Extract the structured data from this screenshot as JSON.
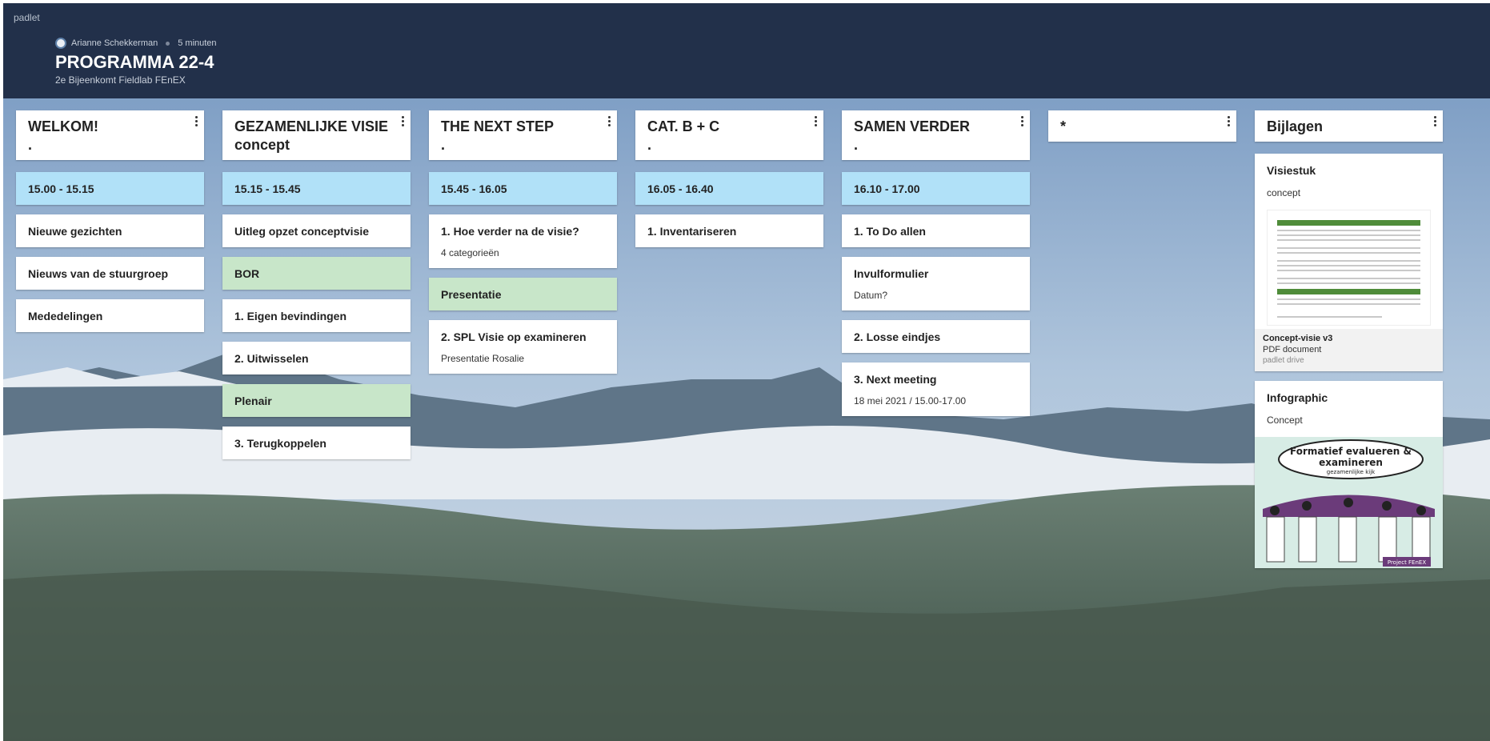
{
  "header": {
    "brand": "padlet",
    "author": "Arianne Schekkerman",
    "time": "5 minuten",
    "title": "PROGRAMMA 22-4",
    "subtitle": "2e Bijeenkomt Fieldlab FEnEX"
  },
  "columns": [
    {
      "title": "WELKOM!",
      "subtitle": ".",
      "time": "15.00 - 15.15",
      "cards": [
        {
          "title": "Nieuwe gezichten",
          "body": "",
          "color": "white"
        },
        {
          "title": "Nieuws van de stuurgroep",
          "body": "",
          "color": "white"
        },
        {
          "title": "Mededelingen",
          "body": "",
          "color": "white"
        }
      ]
    },
    {
      "title": "GEZAMENLIJKE VISIE",
      "subtitle": "concept",
      "time": "15.15 - 15.45",
      "cards": [
        {
          "title": "Uitleg opzet conceptvisie",
          "body": "",
          "color": "white"
        },
        {
          "title": "BOR",
          "body": "",
          "color": "green"
        },
        {
          "title": "1. Eigen bevindingen",
          "body": "",
          "color": "white"
        },
        {
          "title": "2. Uitwisselen",
          "body": "",
          "color": "white"
        },
        {
          "title": "Plenair",
          "body": "",
          "color": "green"
        },
        {
          "title": "3. Terugkoppelen",
          "body": "",
          "color": "white"
        }
      ]
    },
    {
      "title": "THE NEXT STEP",
      "subtitle": ".",
      "time": "15.45 - 16.05",
      "cards": [
        {
          "title": "1. Hoe verder na de visie?",
          "body": "4 categorieën",
          "color": "white"
        },
        {
          "title": "Presentatie",
          "body": "",
          "color": "green"
        },
        {
          "title": "2. SPL Visie op examineren",
          "body": "Presentatie Rosalie",
          "color": "white"
        }
      ]
    },
    {
      "title": "CAT. B + C",
      "subtitle": ".",
      "time": "16.05 - 16.40",
      "cards": [
        {
          "title": "1. Inventariseren",
          "body": "",
          "color": "white"
        }
      ]
    },
    {
      "title": "SAMEN VERDER",
      "subtitle": ".",
      "time": "16.10 - 17.00",
      "cards": [
        {
          "title": "1. To Do allen",
          "body": "",
          "color": "white"
        },
        {
          "title": "Invulformulier",
          "body": "Datum?",
          "color": "white"
        },
        {
          "title": "2. Losse eindjes",
          "body": "",
          "color": "white"
        },
        {
          "title": "3. Next meeting",
          "body": "18 mei 2021 / 15.00-17.00",
          "color": "white"
        }
      ]
    },
    {
      "title": "*",
      "subtitle": "",
      "time": "",
      "cards": []
    }
  ],
  "attachments": {
    "title": "Bijlagen",
    "visiestuk": {
      "title": "Visiestuk",
      "body": "concept",
      "file_name": "Concept-visie v3",
      "file_type": "PDF document",
      "source": "padlet drive"
    },
    "infographic": {
      "title": "Infographic",
      "body": "Concept",
      "image_text_1": "Formatief evalueren &",
      "image_text_2": "examineren",
      "image_text_3": "gezamenlijke kijk",
      "image_badge": "Project FEnEX"
    }
  },
  "colors": {
    "header_bg": "#22304a",
    "time_card": "#b1e1f8",
    "green_card": "#c8e6c9"
  },
  "icons": {
    "menu": "kebab-menu-icon",
    "avatar": "avatar"
  }
}
